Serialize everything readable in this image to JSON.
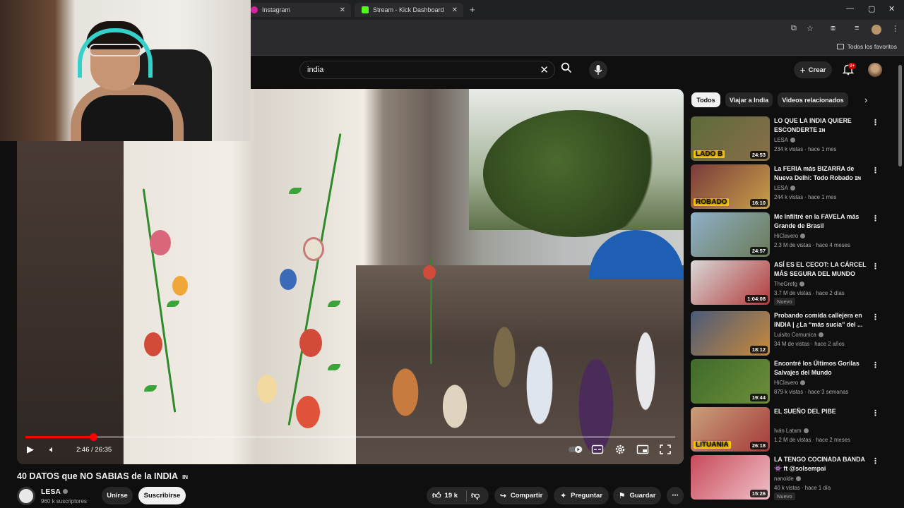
{
  "browser": {
    "tabs": [
      {
        "label": "Instagram",
        "icon_color": "#d6249f"
      },
      {
        "label": "Stream - Kick Dashboard",
        "icon_color": "#53fc18"
      }
    ],
    "bookmarks_all": "Todos los favoritos"
  },
  "youtube": {
    "search_value": "india",
    "create_label": "Crear",
    "notifications_badge": "9+"
  },
  "player": {
    "time": "2:46 / 26:35",
    "progress": 0.104
  },
  "video": {
    "title": "40 DATOS que NO SABIAS de la INDIA",
    "title_flag": "IN",
    "channel": "LESA",
    "subscribers": "960 k suscriptores",
    "join_label": "Unirse",
    "subscribe_label": "Suscribirse",
    "likes": "19 k",
    "share_label": "Compartir",
    "ask_label": "Preguntar",
    "save_label": "Guardar"
  },
  "chips": [
    "Todos",
    "Viajar a India",
    "Videos relacionados"
  ],
  "recommendations": [
    {
      "title": "LO QUE LA INDIA QUIERE ESCONDERTE ɪɴ",
      "channel": "LESA",
      "stats": "234 k vistas · hace 1 mes",
      "duration": "24:53",
      "thumb_text": "LADO B",
      "badge": "",
      "thumb_colors": [
        "#5c6b3a",
        "#8a6e4a"
      ]
    },
    {
      "title": "La FERIA más BIZARRA de Nueva Delhi: Todo Robado ɪɴ",
      "channel": "LESA",
      "stats": "244 k vistas · hace 1 mes",
      "duration": "16:10",
      "thumb_text": "ROBADO",
      "badge": "",
      "thumb_colors": [
        "#7a3b3b",
        "#c9a04a"
      ]
    },
    {
      "title": "Me Infiltré en la FAVELA más Grande de Brasil",
      "channel": "HiClavero",
      "stats": "2.3 M de vistas · hace 4 meses",
      "duration": "24:57",
      "thumb_text": "",
      "badge": "",
      "thumb_colors": [
        "#8fb0c8",
        "#6a7a56"
      ]
    },
    {
      "title": "ASÍ ES EL CECOT: LA CÁRCEL MÁS SEGURA DEL MUNDO",
      "channel": "TheGrefg",
      "stats": "3.7 M de vistas · hace 2 días",
      "duration": "1:04:08",
      "thumb_text": "",
      "badge": "Nuevo",
      "thumb_colors": [
        "#d8d8d8",
        "#b33a3a"
      ]
    },
    {
      "title": "Probando comida callejera en INDIA | ¿La “más sucia” del ...",
      "channel": "Luisito Comunica",
      "stats": "34 M de vistas · hace 2 años",
      "duration": "18:12",
      "thumb_text": "",
      "badge": "",
      "thumb_colors": [
        "#4a5a7a",
        "#c98a3a"
      ]
    },
    {
      "title": "Encontré los Últimos Gorilas Salvajes del Mundo",
      "channel": "HiClavero",
      "stats": "879 k vistas · hace 3 semanas",
      "duration": "19:44",
      "thumb_text": "",
      "badge": "",
      "thumb_colors": [
        "#3f6a2a",
        "#6d8f3a"
      ]
    },
    {
      "title": "EL SUEÑO DEL PIBE",
      "channel": "Iván Latam",
      "stats": "1.2 M de vistas · hace 2 meses",
      "duration": "26:18",
      "thumb_text": "LITUANIA",
      "badge": "",
      "thumb_colors": [
        "#c8a07a",
        "#a53a3a"
      ]
    },
    {
      "title": "LA TENGO COCINADA BANDA 👾 ft @solsempai",
      "channel": "nanolde",
      "stats": "40 k vistas · hace 1 día",
      "duration": "15:26",
      "thumb_text": "",
      "badge": "Nuevo",
      "thumb_colors": [
        "#c84a5a",
        "#f0c0c8"
      ]
    }
  ]
}
